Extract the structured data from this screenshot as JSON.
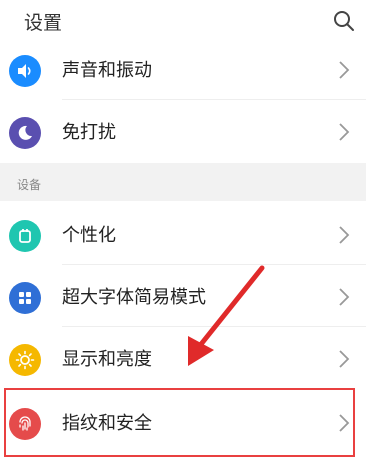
{
  "header": {
    "title": "设置",
    "search_icon": "search-icon"
  },
  "items_top": [
    {
      "label": "声音和振动",
      "icon": "volume-icon",
      "color": "#1a8cff"
    },
    {
      "label": "免打扰",
      "icon": "moon-icon",
      "color": "#5a4fb0"
    }
  ],
  "section": {
    "label": "设备"
  },
  "items_device": [
    {
      "label": "个性化",
      "icon": "theme-icon",
      "color": "#1fc6b0"
    },
    {
      "label": "超大字体简易模式",
      "icon": "grid-icon",
      "color": "#2f6fd6"
    },
    {
      "label": "显示和亮度",
      "icon": "sun-icon",
      "color": "#f5b800"
    },
    {
      "label": "指纹和安全",
      "icon": "fingerprint-icon",
      "color": "#e54b4b"
    }
  ],
  "annotation": {
    "highlight_color": "#e94040",
    "arrow_color": "#e02a2a"
  }
}
